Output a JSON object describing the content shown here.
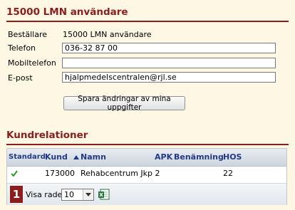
{
  "user_section": {
    "title": "15000 LMN användare",
    "orderer_label": "Beställare",
    "orderer_value": "15000 LMN användare",
    "phone_label": "Telefon",
    "phone_value": "036-32 87 00",
    "mobile_label": "Mobiltelefon",
    "mobile_value": "",
    "email_label": "E-post",
    "email_value": "hjalpmedelscentralen@rjl.se",
    "save_button": "Spara ändringar av mina uppgifter"
  },
  "relations_section": {
    "title": "Kundrelationer",
    "columns": {
      "standard": "Standard",
      "kund": "Kund",
      "namn": "Namn",
      "apk": "APK",
      "benamning": "Benämning",
      "hos": "HOS"
    },
    "rows": [
      {
        "standard": true,
        "kund": "173000",
        "namn": "Rehabcentrum Jkp 2",
        "apk": "",
        "benamning": "",
        "hos": "22"
      }
    ],
    "footer": {
      "page_number": "1",
      "rows_label": "Visa rader",
      "rows_value": "10"
    }
  },
  "colors": {
    "brand": "#8b1d1d",
    "header_text": "#223a86",
    "check": "#2e9b2e",
    "background": "#fdf7e3"
  }
}
